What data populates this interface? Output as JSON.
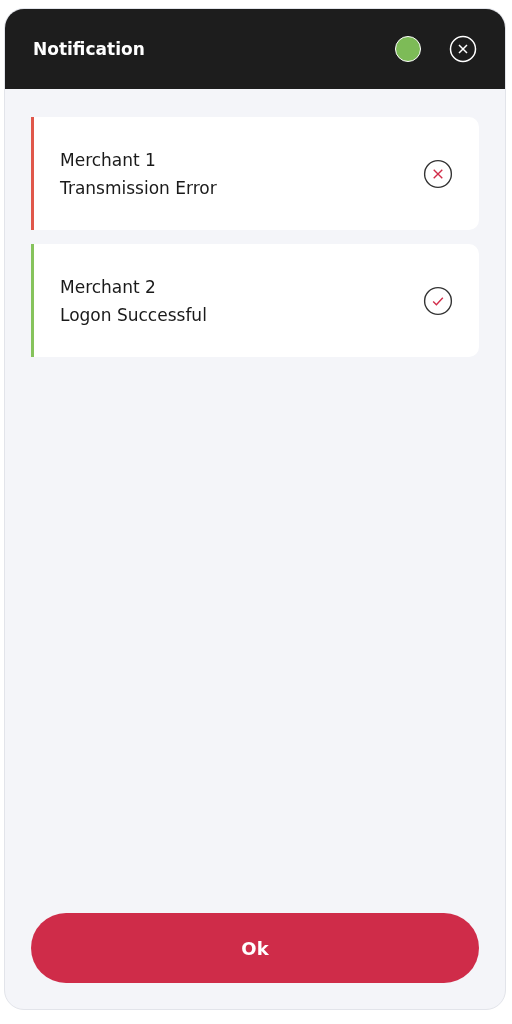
{
  "window": {
    "title": "Notification",
    "online": true
  },
  "notifications": [
    {
      "merchant": "Merchant 1",
      "message": "Transmission Error",
      "kind": "error"
    },
    {
      "merchant": "Merchant 2",
      "message": "Logon Successful",
      "kind": "success"
    }
  ],
  "buttons": [
    "Ok"
  ]
}
